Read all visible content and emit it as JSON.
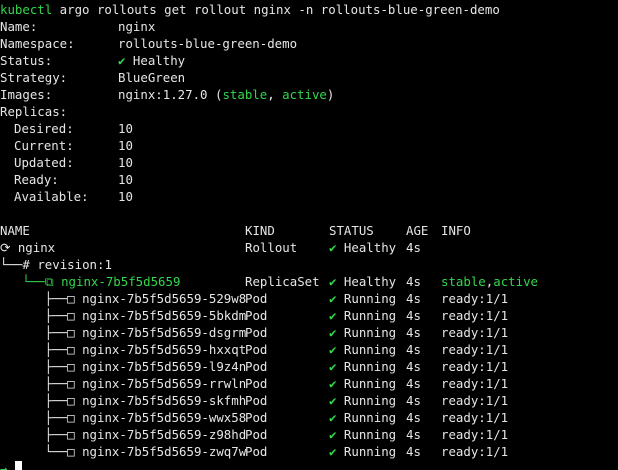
{
  "command": {
    "program": "kubectl",
    "args": " argo rollouts get rollout nginx -n rollouts-blue-green-demo"
  },
  "summary": {
    "name_label": "Name:",
    "name_value": "nginx",
    "namespace_label": "Namespace:",
    "namespace_value": "rollouts-blue-green-demo",
    "status_label": "Status:",
    "status_icon": "✔",
    "status_value": " Healthy",
    "strategy_label": "Strategy:",
    "strategy_value": "BlueGreen",
    "images_label": "Images:",
    "image_value": "nginx:1.27.0 (",
    "image_tag_stable": "stable",
    "image_sep": ", ",
    "image_tag_active": "active",
    "image_close": ")",
    "replicas_label": "Replicas:",
    "desired_label": "Desired:",
    "desired_value": "10",
    "current_label": "Current:",
    "current_value": "10",
    "updated_label": "Updated:",
    "updated_value": "10",
    "ready_label": "Ready:",
    "ready_value": "10",
    "available_label": "Available:",
    "available_value": "10"
  },
  "table": {
    "headers": {
      "name": "NAME",
      "kind": "KIND",
      "status": "STATUS",
      "age": "AGE",
      "info": "INFO"
    },
    "rollout": {
      "prefix": "⟳ ",
      "name": "nginx",
      "kind": "Rollout",
      "status_icon": "✔",
      "status": " Healthy",
      "age": "4s"
    },
    "revision": {
      "prefix": "└──# ",
      "label": "revision:1"
    },
    "replicaset": {
      "prefix": "   └──⧉ ",
      "name": "nginx-7b5f5d5659",
      "kind": "ReplicaSet",
      "status_icon": "✔",
      "status": " Healthy",
      "age": "4s",
      "info_stable": "stable",
      "info_sep": ",",
      "info_active": "active"
    },
    "pods": [
      {
        "prefix": "      ├──□ ",
        "name": "nginx-7b5f5d5659-529w8",
        "kind": "Pod",
        "status_icon": "✔",
        "status": " Running",
        "age": "4s",
        "info": "ready:1/1"
      },
      {
        "prefix": "      ├──□ ",
        "name": "nginx-7b5f5d5659-5bkdm",
        "kind": "Pod",
        "status_icon": "✔",
        "status": " Running",
        "age": "4s",
        "info": "ready:1/1"
      },
      {
        "prefix": "      ├──□ ",
        "name": "nginx-7b5f5d5659-dsgrm",
        "kind": "Pod",
        "status_icon": "✔",
        "status": " Running",
        "age": "4s",
        "info": "ready:1/1"
      },
      {
        "prefix": "      ├──□ ",
        "name": "nginx-7b5f5d5659-hxxqt",
        "kind": "Pod",
        "status_icon": "✔",
        "status": " Running",
        "age": "4s",
        "info": "ready:1/1"
      },
      {
        "prefix": "      ├──□ ",
        "name": "nginx-7b5f5d5659-l9z4n",
        "kind": "Pod",
        "status_icon": "✔",
        "status": " Running",
        "age": "4s",
        "info": "ready:1/1"
      },
      {
        "prefix": "      ├──□ ",
        "name": "nginx-7b5f5d5659-rrwln",
        "kind": "Pod",
        "status_icon": "✔",
        "status": " Running",
        "age": "4s",
        "info": "ready:1/1"
      },
      {
        "prefix": "      ├──□ ",
        "name": "nginx-7b5f5d5659-skfmh",
        "kind": "Pod",
        "status_icon": "✔",
        "status": " Running",
        "age": "4s",
        "info": "ready:1/1"
      },
      {
        "prefix": "      ├──□ ",
        "name": "nginx-7b5f5d5659-wwx58",
        "kind": "Pod",
        "status_icon": "✔",
        "status": " Running",
        "age": "4s",
        "info": "ready:1/1"
      },
      {
        "prefix": "      ├──□ ",
        "name": "nginx-7b5f5d5659-z98hd",
        "kind": "Pod",
        "status_icon": "✔",
        "status": " Running",
        "age": "4s",
        "info": "ready:1/1"
      },
      {
        "prefix": "      └──□ ",
        "name": "nginx-7b5f5d5659-zwq7w",
        "kind": "Pod",
        "status_icon": "✔",
        "status": " Running",
        "age": "4s",
        "info": "ready:1/1"
      }
    ]
  },
  "prompt": {
    "symbol": "→ "
  },
  "colors": {
    "background": "#000000",
    "text": "#e6e6e6",
    "accent_green": "#32d74b"
  }
}
